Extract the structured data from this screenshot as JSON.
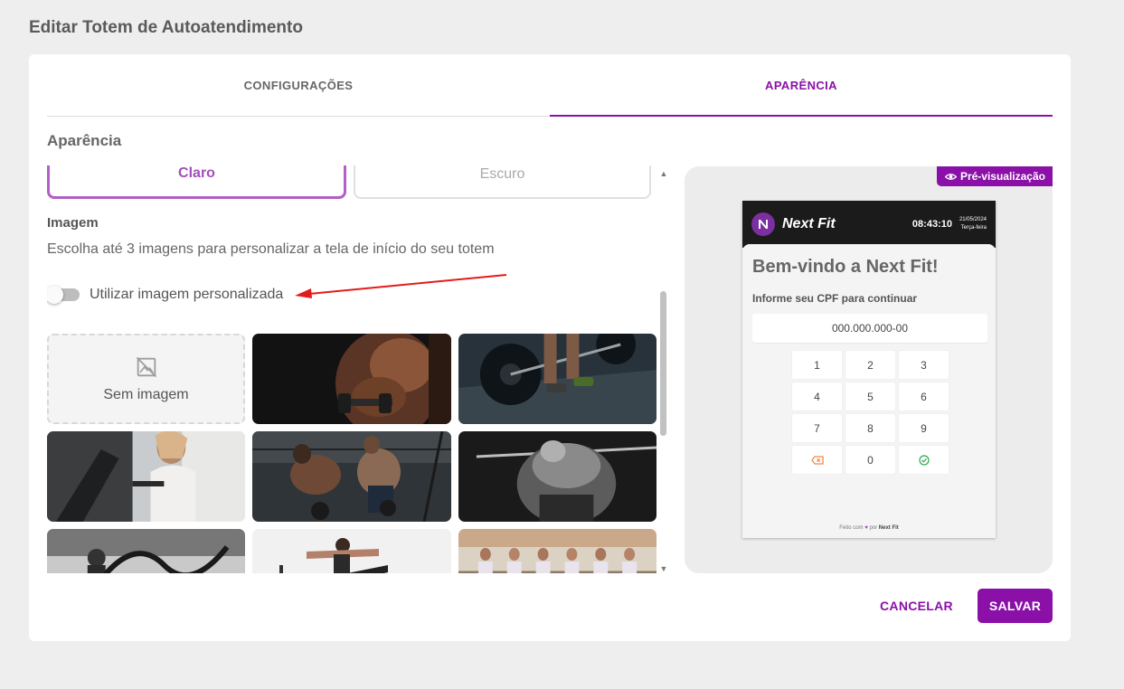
{
  "page": {
    "title": "Editar Totem de Autoatendimento"
  },
  "tabs": [
    {
      "label": "CONFIGURAÇÕES",
      "active": false
    },
    {
      "label": "APARÊNCIA",
      "active": true
    }
  ],
  "appearance": {
    "section_title": "Aparência",
    "themes": {
      "light": "Claro",
      "dark": "Escuro",
      "selected": "Claro"
    },
    "image_label": "Imagem",
    "image_description": "Escolha até 3 imagens para personalizar a tela de início do seu totem",
    "custom_image_toggle": {
      "label": "Utilizar imagem personalizada",
      "on": false
    },
    "no_image_label": "Sem imagem",
    "image_options": [
      "Sem imagem",
      "Homem com halteres",
      "Levantamento de barra",
      "Mulher na bicicleta ergométrica",
      "Treino funcional com kettlebell",
      "Agachamento com barra",
      "Treino com cordas",
      "Alongamento em dupla",
      "Aula de balé na barra"
    ]
  },
  "preview": {
    "badge": "Pré-visualização",
    "brand": "Next Fit",
    "time": "08:43:10",
    "date": "21/05/2024",
    "weekday": "Terça-feira",
    "welcome": "Bem-vindo a Next Fit!",
    "cpf_label": "Informe seu CPF para continuar",
    "cpf_placeholder": "000.000.000-00",
    "keys": [
      "1",
      "2",
      "3",
      "4",
      "5",
      "6",
      "7",
      "8",
      "9",
      "",
      "0",
      ""
    ],
    "footer_pre": "Feito com",
    "footer_mid": "por",
    "footer_brand": "Next Fit"
  },
  "actions": {
    "cancel": "CANCELAR",
    "save": "SALVAR"
  },
  "colors": {
    "accent": "#8a10a8",
    "theme_border": "#b15fc6",
    "arrow": "#e51b1b"
  }
}
